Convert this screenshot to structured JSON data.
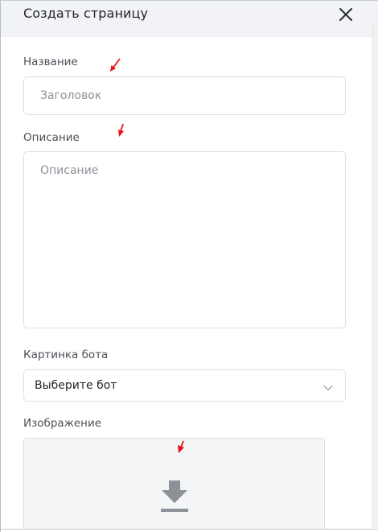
{
  "dialog": {
    "title": "Создать страницу",
    "close_icon": "close-icon"
  },
  "form": {
    "name": {
      "label": "Название",
      "placeholder": "Заголовок",
      "value": ""
    },
    "description": {
      "label": "Описание",
      "placeholder": "Описание",
      "value": ""
    },
    "bot_picture": {
      "label": "Картинка бота",
      "selected": "Выберите бот",
      "chevron_icon": "chevron-down-icon"
    },
    "image": {
      "label": "Изображение",
      "upload_icon": "download-icon"
    }
  },
  "annotations": {
    "arrow_icon": "red-arrow-icon",
    "color": "#e8121b"
  }
}
